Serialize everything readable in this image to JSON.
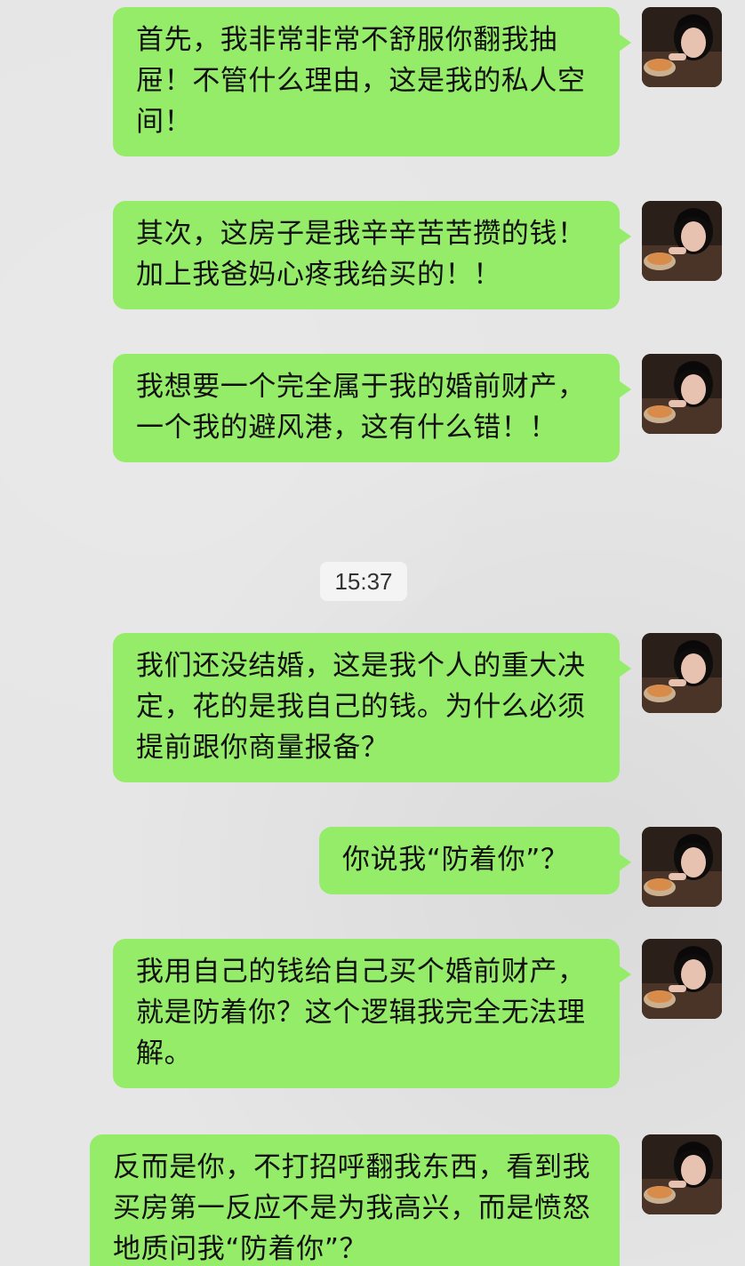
{
  "conversation": {
    "timestamp": "15:37",
    "messages": [
      {
        "text": "首先，我非常非常不舒服你翻我抽屉！不管什么理由，这是我的私人空间！"
      },
      {
        "text": "其次，这房子是我辛辛苦苦攒的钱！加上我爸妈心疼我给买的！！"
      },
      {
        "text": "我想要一个完全属于我的婚前财产，一个我的避风港，这有什么错！！"
      },
      {
        "text": "我们还没结婚，这是我个人的重大决定，花的是我自己的钱。为什么必须提前跟你商量报备？"
      },
      {
        "text": "你说我“防着你”？"
      },
      {
        "text": "我用自己的钱给自己买个婚前财产，就是防着你？这个逻辑我完全无法理解。"
      },
      {
        "text": "反而是你，不打招呼翻我东西，看到我买房第一反应不是为我高兴，而是愤怒地质问我“防着你”？"
      }
    ]
  },
  "colors": {
    "background": "#e6e6e6",
    "bubble": "#95ec69",
    "timestamp_bg": "#f4f4f4"
  },
  "icons": {
    "avatar": "user-avatar-photo"
  }
}
